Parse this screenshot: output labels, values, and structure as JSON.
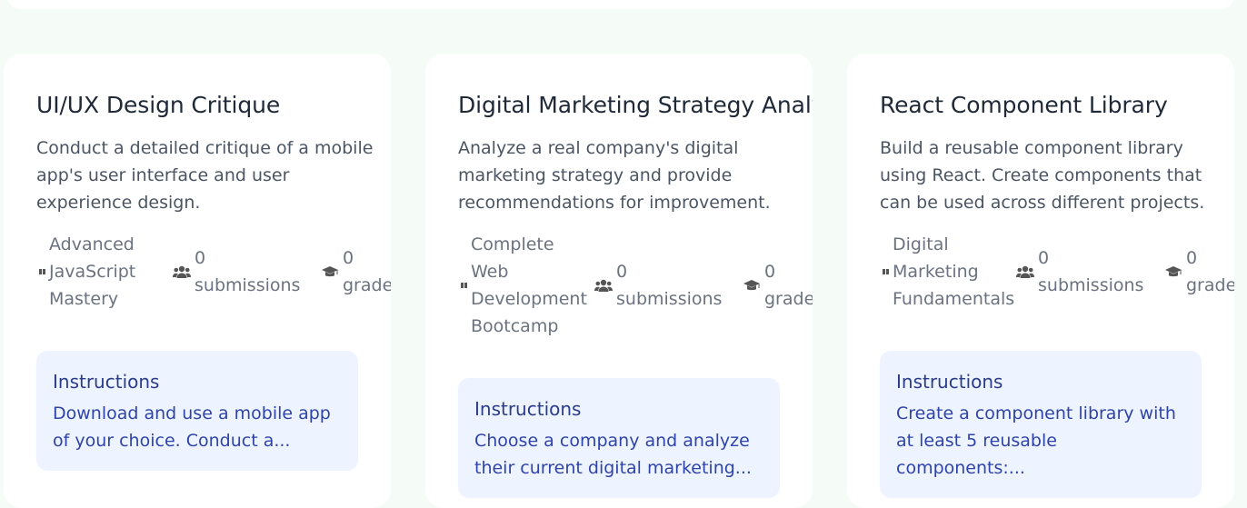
{
  "cards": [
    {
      "title": "UI/UX Design Critique",
      "description": "Conduct a detailed critique of a mobile app's user interface and user experience design.",
      "course": "Advanced JavaScript Mastery",
      "submissions_count": "0",
      "submissions_label": "submissions",
      "graded_count": "0",
      "graded_label": "graded",
      "instructions_label": "Instructions",
      "instructions_text": "Download and use a mobile app of your choice. Conduct a..."
    },
    {
      "title": "Digital Marketing Strategy Analysis",
      "description": "Analyze a real company's digital marketing strategy and provide recommendations for improvement.",
      "course": "Complete Web Development Bootcamp",
      "submissions_count": "0",
      "submissions_label": "submissions",
      "graded_count": "0",
      "graded_label": "graded",
      "instructions_label": "Instructions",
      "instructions_text": "Choose a company and analyze their current digital marketing..."
    },
    {
      "title": "React Component Library",
      "description": "Build a reusable component library using React. Create components that can be used across different projects.",
      "course": "Digital Marketing Fundamentals",
      "submissions_count": "0",
      "submissions_label": "submissions",
      "graded_count": "0",
      "graded_label": "graded",
      "instructions_label": "Instructions",
      "instructions_text": "Create a component library with at least 5 reusable components:..."
    }
  ],
  "icons": {
    "course": "book-icon",
    "submissions": "users-icon",
    "graded": "graduation-cap-icon"
  }
}
